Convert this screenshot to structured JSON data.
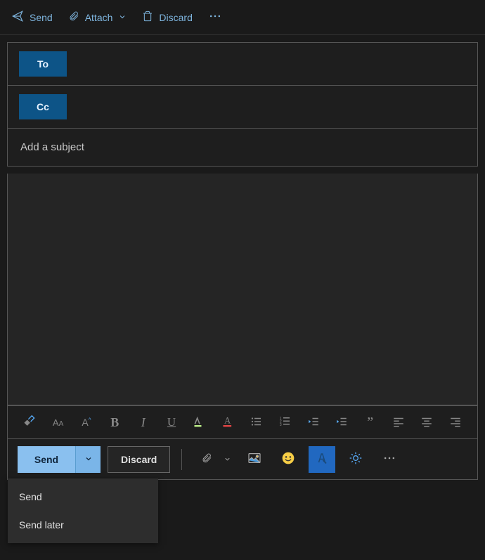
{
  "top": {
    "send": "Send",
    "attach": "Attach",
    "discard": "Discard"
  },
  "fields": {
    "to": "To",
    "cc": "Cc"
  },
  "subject_placeholder": "Add a subject",
  "bottom": {
    "send": "Send",
    "discard": "Discard"
  },
  "menu": {
    "send": "Send",
    "send_later": "Send later"
  },
  "icons": {
    "send_arrow": "send-icon",
    "paperclip": "paperclip-icon",
    "chevron_down": "chevron-down-icon",
    "trash": "trash-icon",
    "more": "more-icon",
    "format_painter": "format-painter-icon",
    "font": "font-icon",
    "font_size": "font-size-icon",
    "bold": "bold-icon",
    "italic": "italic-icon",
    "underline": "underline-icon",
    "highlight": "highlight-icon",
    "font_color": "font-color-icon",
    "bullets": "bullets-icon",
    "numbers": "numbers-icon",
    "outdent": "outdent-icon",
    "indent": "indent-icon",
    "quote": "quote-icon",
    "align_left": "align-left-icon",
    "align_center": "align-center-icon",
    "align_right": "align-right-icon",
    "image": "image-icon",
    "emoji": "emoji-icon",
    "editor": "editor-icon",
    "brightness": "brightness-icon"
  }
}
